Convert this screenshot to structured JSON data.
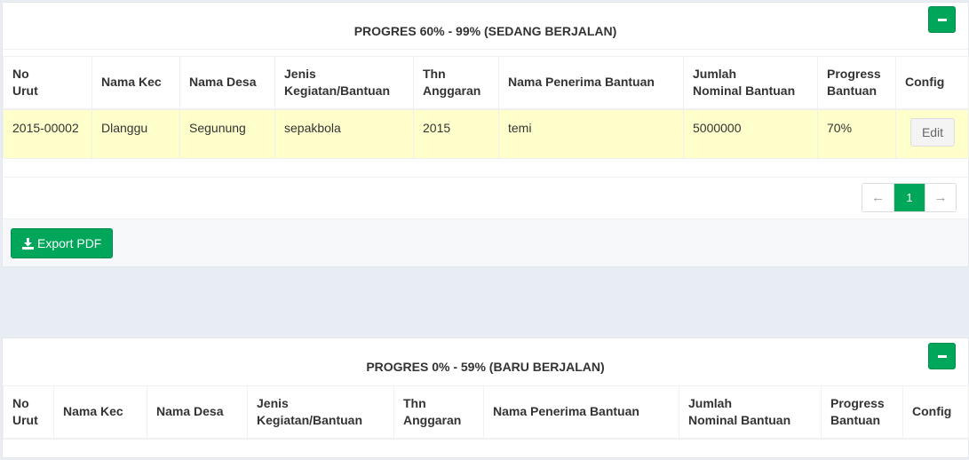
{
  "panel1": {
    "title": "PROGRES 60% - 99% (SEDANG BERJALAN)",
    "collapse_icon": "minus-icon",
    "headers": [
      {
        "l1": "No",
        "l2": "Urut"
      },
      {
        "l1": "Nama Kec",
        "l2": ""
      },
      {
        "l1": "Nama Desa",
        "l2": ""
      },
      {
        "l1": "Jenis",
        "l2": "Kegiatan/Bantuan"
      },
      {
        "l1": "Thn",
        "l2": "Anggaran"
      },
      {
        "l1": "Nama Penerima Bantuan",
        "l2": ""
      },
      {
        "l1": "Jumlah",
        "l2": "Nominal Bantuan"
      },
      {
        "l1": "Progress",
        "l2": "Bantuan"
      },
      {
        "l1": "Config",
        "l2": ""
      }
    ],
    "rows": [
      {
        "no_urut": "2015-00002",
        "kec": "Dlanggu",
        "desa": "Segunung",
        "jenis": "sepakbola",
        "tahun": "2015",
        "penerima": "temi",
        "nominal": "5000000",
        "progress": "70%",
        "edit_label": "Edit"
      }
    ],
    "pagination": {
      "prev": "←",
      "current": "1",
      "next": "→"
    },
    "export_label": "Export PDF",
    "export_icon": "download-icon"
  },
  "panel2": {
    "title": "PROGRES 0% - 59% (BARU BERJALAN)",
    "collapse_icon": "minus-icon",
    "headers": [
      {
        "l1": "No",
        "l2": "Urut"
      },
      {
        "l1": "Nama Kec",
        "l2": ""
      },
      {
        "l1": "Nama Desa",
        "l2": ""
      },
      {
        "l1": "Jenis",
        "l2": "Kegiatan/Bantuan"
      },
      {
        "l1": "Thn",
        "l2": "Anggaran"
      },
      {
        "l1": "Nama Penerima Bantuan",
        "l2": ""
      },
      {
        "l1": "Jumlah",
        "l2": "Nominal Bantuan"
      },
      {
        "l1": "Progress",
        "l2": "Bantuan"
      },
      {
        "l1": "Config",
        "l2": ""
      }
    ]
  },
  "colors": {
    "accent": "#00a65a",
    "row_highlight": "#ffffcc",
    "page_bg": "#e8edf3"
  }
}
